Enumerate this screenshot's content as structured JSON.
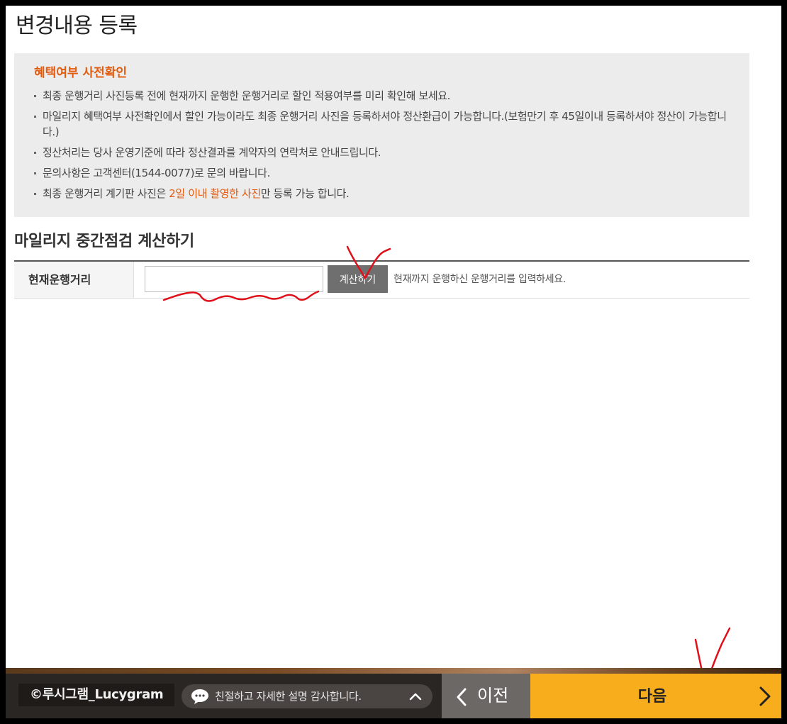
{
  "page": {
    "title": "변경내용 등록"
  },
  "info": {
    "title": "혜택여부 사전확인",
    "items": [
      "최종 운행거리 사진등록 전에 현재까지 운행한 운행거리로 할인 적용여부를 미리 확인해 보세요.",
      "마일리지 혜택여부 사전확인에서 할인 가능이라도 최종 운행거리 사진을 등록하셔야 정산환급이 가능합니다.(보험만기 후 45일이내 등록하셔야 정산이 가능합니다.)",
      "정산처리는 당사 운영기준에 따라 정산결과를 계약자의 연락처로 안내드립니다.",
      "문의사항은 고객센터(1544-0077)로 문의 바랍니다."
    ],
    "last_item": {
      "prefix": "최종 운행거리 계기판 사진은 ",
      "highlight": "2일 이내 촬영한 사진",
      "suffix": "만 등록 가능 합니다."
    },
    "highlight_color": "#e25b0f"
  },
  "calculator": {
    "section_title": "마일리지 중간점검 계산하기",
    "label": "현재운행거리",
    "input_value": "",
    "input_placeholder": "",
    "button_label": "계산하기",
    "hint": "현재까지 운행하신 운행거리를 입력하세요."
  },
  "footer": {
    "brand": "©루시그램_Lucygram",
    "chat_text": "친절하고 자세한 설명 감사합니다.",
    "chat_icon": "speech-bubble-icon",
    "expand_icon": "chevron-up-icon",
    "prev_label": "이전",
    "next_label": "다음",
    "accent_color": "#f8ad1c"
  },
  "annotations": {
    "color": "#e0101a",
    "marks": [
      "checkmark",
      "underline-squiggle",
      "checkmark"
    ]
  }
}
